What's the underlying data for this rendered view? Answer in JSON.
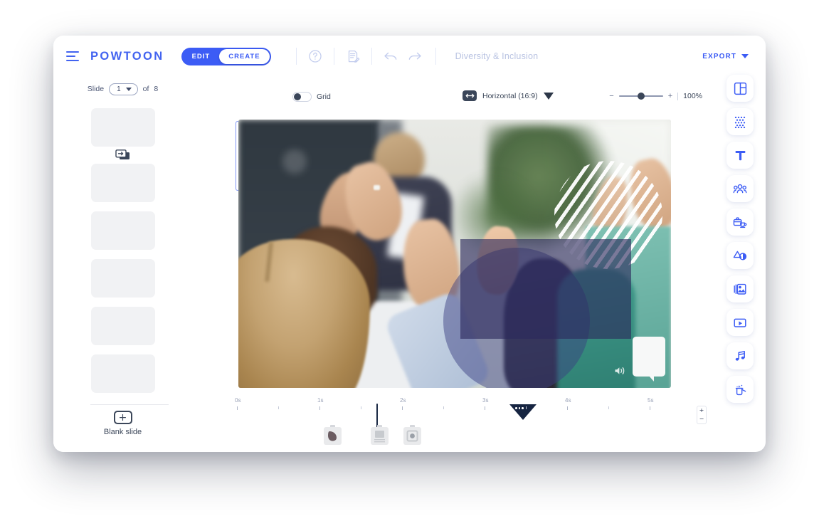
{
  "app": {
    "brand": "POWTOON",
    "document_title": "Diversity &  Inclusion"
  },
  "topbar": {
    "menu_icon": "hamburger-icon",
    "mode_toggle": {
      "active": "EDIT",
      "inactive": "CREATE"
    },
    "help_icon": "question-mark-icon",
    "notes_icon": "script-notes-icon",
    "undo_icon": "undo-arrow-icon",
    "redo_icon": "redo-arrow-icon",
    "export_label": "EXPORT",
    "export_caret": "chevron-down-icon"
  },
  "slide_panel": {
    "slide_word": "Slide",
    "current_slide": "1",
    "of_word": "of",
    "total_slides": "8",
    "transition_icon": "slide-transition-icon",
    "collapse_icon": "chevron-left-icon",
    "blank_slide_label": "Blank slide",
    "blank_slide_icon": "plus-icon"
  },
  "canvas_toolbar": {
    "grid_label": "Grid",
    "grid_on": false,
    "ratio_icon": "horizontal-arrows-icon",
    "ratio_label": "Horizontal (16:9)",
    "ratio_caret": "caret-down-icon",
    "zoom_out_label": "−",
    "zoom_in_label": "+",
    "zoom_percent": "100%"
  },
  "canvas": {
    "scene_description": "Blurred photo of colleagues applauding and high-fiving in an office",
    "overlays": [
      {
        "name": "striped-circle-overlay",
        "color": "#ffffff"
      },
      {
        "name": "purple-rectangle-overlay",
        "color": "#2b285c"
      },
      {
        "name": "blue-circle-overlay",
        "color": "#3a3f82"
      },
      {
        "name": "white-callout-shape",
        "color": "#f7f8f8"
      }
    ],
    "speaker_icon": "volume-speaker-icon"
  },
  "timeline": {
    "ticks": [
      "0s",
      "1s",
      "2s",
      "3s",
      "4s",
      "5s"
    ],
    "playhead_position_s": "1.5",
    "marker_icon": "scene-marker-icon",
    "objects": [
      {
        "name": "timeline-object-shape"
      },
      {
        "name": "timeline-object-text"
      },
      {
        "name": "timeline-object-image"
      }
    ],
    "zoom_in_label": "+",
    "zoom_out_label": "−"
  },
  "tool_rail": {
    "items": [
      {
        "icon": "layouts-icon",
        "label": "Layouts"
      },
      {
        "icon": "backgrounds-icon",
        "label": "Backgrounds"
      },
      {
        "icon": "text-icon",
        "label": "Text"
      },
      {
        "icon": "characters-icon",
        "label": "Characters"
      },
      {
        "icon": "props-icon",
        "label": "Props"
      },
      {
        "icon": "shapes-icon",
        "label": "Shapes"
      },
      {
        "icon": "images-icon",
        "label": "Images"
      },
      {
        "icon": "video-icon",
        "label": "Video"
      },
      {
        "icon": "music-icon",
        "label": "Music"
      },
      {
        "icon": "effects-icon",
        "label": "Effects"
      }
    ]
  },
  "colors": {
    "brand_blue": "#3c5cf5",
    "dark_navy": "#3b4659",
    "muted_text": "#b9c3e2"
  }
}
